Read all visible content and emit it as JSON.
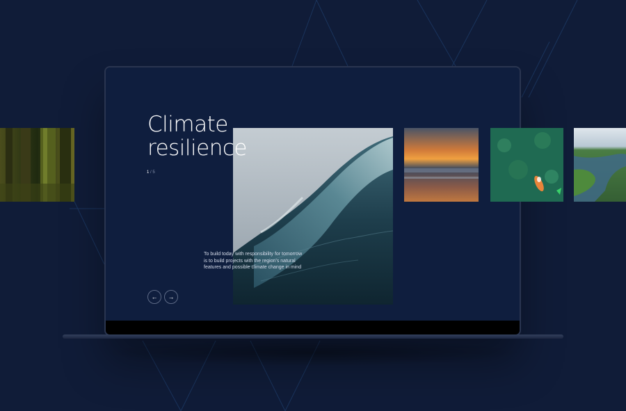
{
  "slide": {
    "title_lines": [
      "Climate",
      "resilience"
    ],
    "counter_current": "1",
    "counter_separator": "/",
    "counter_total": "5",
    "description": "To build today with responsibility for tomorrow is to build projects with the region's natural features and possible climate change in mind"
  },
  "navigation": {
    "prev_icon": "←",
    "next_icon": "→"
  },
  "gallery": {
    "images": [
      "forest",
      "ocean-wave",
      "sunset-beach",
      "koi-pond",
      "river-landscape"
    ]
  },
  "colors": {
    "background": "#101c38",
    "screen": "#0f1e3e",
    "text": "#ffffff",
    "accent_line": "#1f4a7a"
  }
}
